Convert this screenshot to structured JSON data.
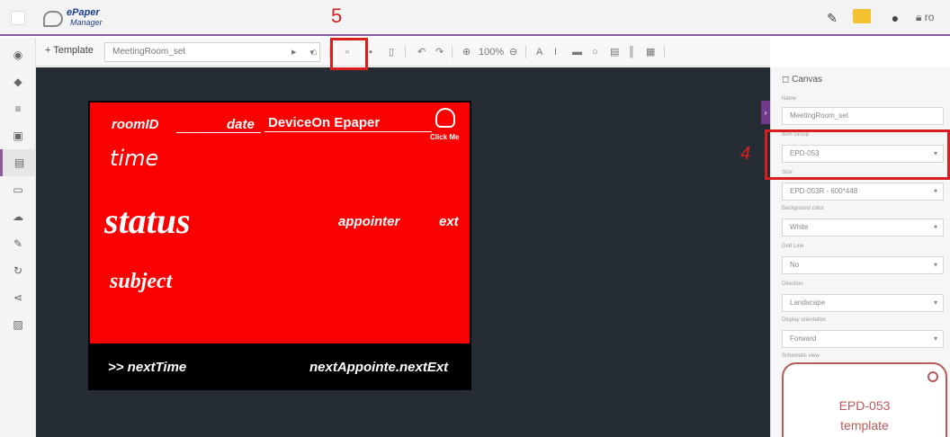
{
  "app": {
    "logo_line1": "ePaper",
    "logo_line2": "Manager",
    "user": "ro"
  },
  "toolbar": {
    "add_label": "+ Template",
    "template_value": "MeetingRoom_set",
    "zoom": "100%"
  },
  "annotations": {
    "marker5": "5",
    "marker4": "4"
  },
  "canvas": {
    "roomid": "roomID",
    "date": "date",
    "device": "DeviceOn Epaper",
    "click_me": "Click Me",
    "time": "time",
    "status": "status",
    "appointer": "appointer",
    "ext": "ext",
    "subject": "subject",
    "next_time": ">>  nextTime",
    "next_appointer": "nextAppointe.nextExt"
  },
  "panel": {
    "title": "Canvas",
    "name_label": "Name",
    "name_value": "MeetingRoom_set",
    "group_label": "Item Group",
    "group_value": "EPD-053",
    "size_label": "Size",
    "size_value": "EPD-053R - 600*448",
    "bg_label": "Background color",
    "bg_value": "White",
    "grid_label": "Grid Line",
    "grid_value": "No",
    "direction_label": "Direction",
    "direction_value": "Landscape",
    "display_label": "Display orientation",
    "display_value": "Forward",
    "schematic_label": "Schematic view",
    "card_line1": "EPD-053",
    "card_line2": "template"
  },
  "colors": {
    "accent": "#8a5a9a",
    "canvas_bg": "#252c34",
    "epaper_red": "#fa0000",
    "callout": "#d81e1e"
  },
  "icons": [
    "menu-icon",
    "magic-wand-icon",
    "notification-icon",
    "help-icon",
    "lock-icon",
    "save-icon",
    "preview-icon",
    "undo-icon",
    "redo-icon",
    "zoom-in-icon",
    "zoom-out-icon",
    "text-icon",
    "line-icon",
    "rect-icon",
    "circle-icon",
    "image-icon",
    "barcode-icon",
    "qrcode-icon"
  ]
}
